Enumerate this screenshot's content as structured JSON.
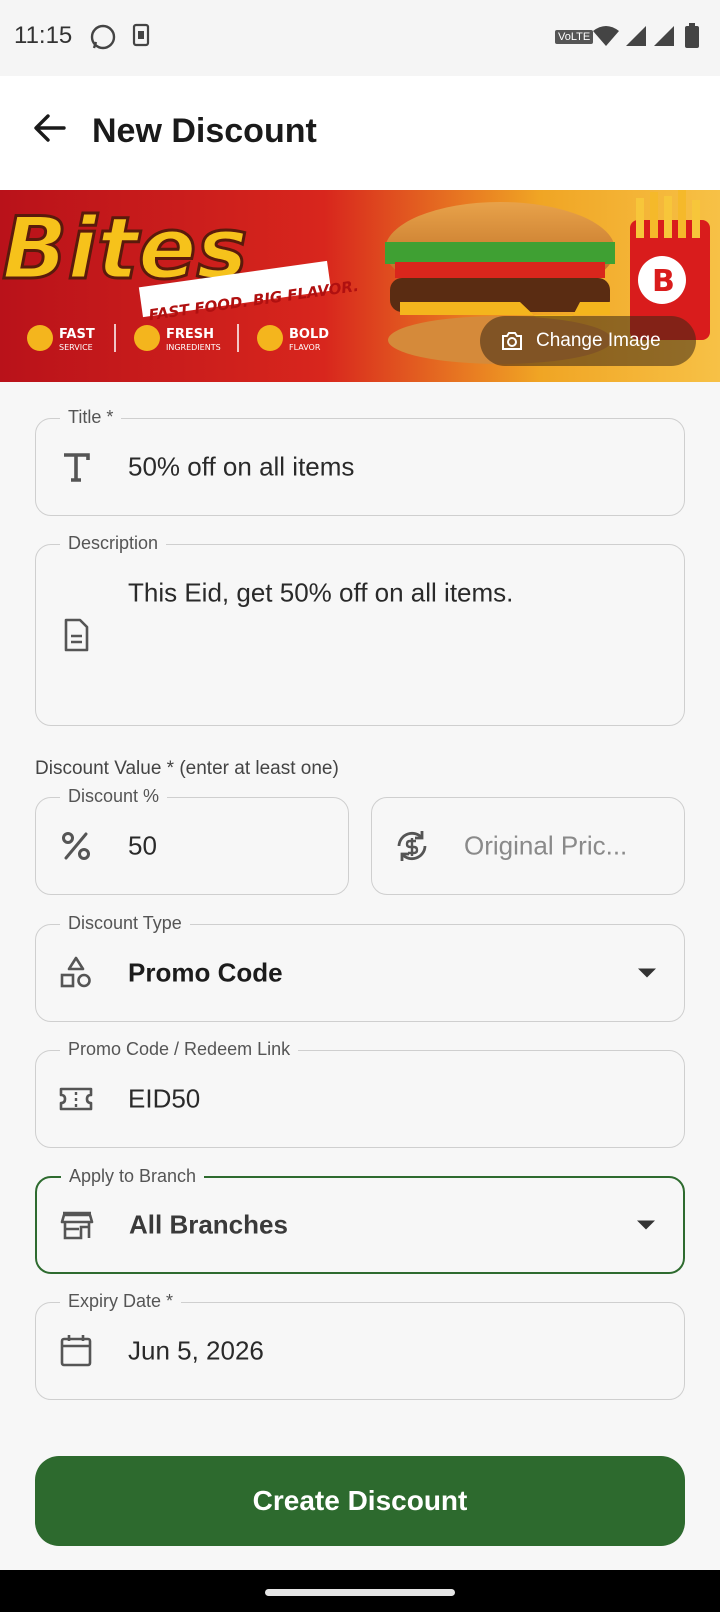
{
  "status_bar": {
    "time": "11:15",
    "network_label": "VoLTE"
  },
  "app_bar": {
    "title": "New Discount",
    "back_icon": "arrow-left-icon"
  },
  "banner": {
    "brand_text": "Bites",
    "tagline": "FAST FOOD. BIG FLAVOR.",
    "features": [
      {
        "title": "FAST",
        "subtitle": "SERVICE"
      },
      {
        "title": "FRESH",
        "subtitle": "INGREDIENTS"
      },
      {
        "title": "BOLD",
        "subtitle": "FLAVOR"
      }
    ],
    "badge_letter": "B",
    "change_image_label": "Change Image"
  },
  "form": {
    "title": {
      "label": "Title *",
      "value": "50% off on all items",
      "icon": "text-format-icon"
    },
    "description": {
      "label": "Description",
      "value": "This Eid, get 50% off on all items.",
      "icon": "document-icon"
    },
    "discount_value_label": "Discount Value *  (enter at least one)",
    "discount_percent": {
      "label": "Discount %",
      "value": "50",
      "icon": "percent-icon"
    },
    "original_price": {
      "placeholder": "Original Pric...",
      "icon": "price-exchange-icon"
    },
    "discount_type": {
      "label": "Discount Type",
      "value": "Promo Code",
      "icon": "shapes-icon"
    },
    "promo_code": {
      "label": "Promo Code / Redeem Link",
      "value": "EID50",
      "icon": "ticket-icon"
    },
    "branch": {
      "label": "Apply to Branch",
      "value": "All Branches",
      "icon": "store-icon"
    },
    "expiry": {
      "label": "Expiry Date *",
      "value": "Jun 5, 2026",
      "icon": "calendar-icon"
    }
  },
  "submit": {
    "label": "Create Discount"
  },
  "colors": {
    "primary": "#2d6a2e",
    "banner_red": "#d81e1e",
    "banner_yellow": "#f2b431"
  }
}
